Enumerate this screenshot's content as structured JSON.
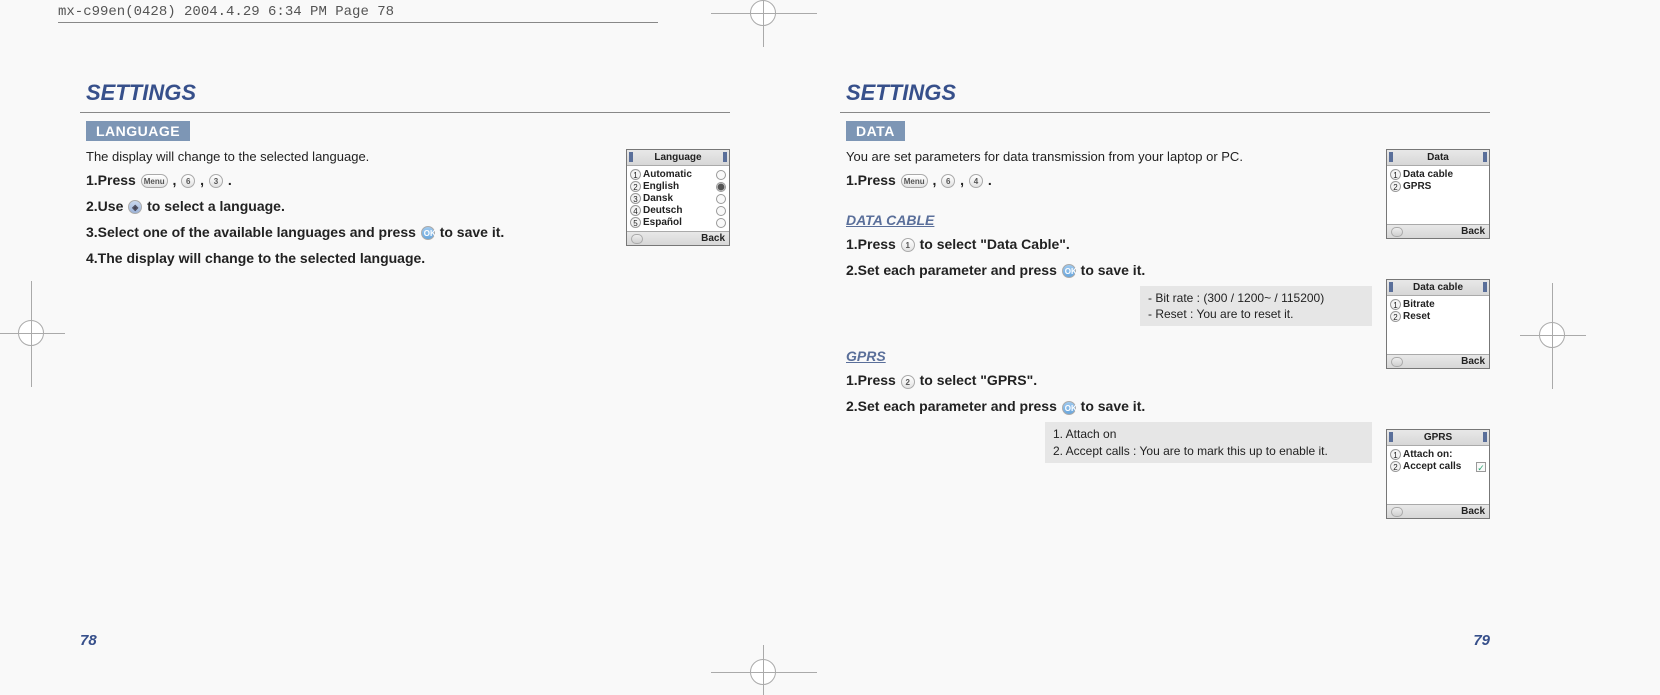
{
  "header": "mx-c99en(0428)  2004.4.29  6:34 PM  Page 78",
  "pages": {
    "left": {
      "title": "SETTINGS",
      "section": "LANGUAGE",
      "intro": "The display will change to the selected language.",
      "step1_a": "1.Press ",
      "step1_b": " , ",
      "step1_c": " , ",
      "step1_d": " .",
      "key1": "Menu",
      "key2": "6",
      "key3": "3",
      "step2_a": "2.Use ",
      "step2_b": " to select a language.",
      "step3_a": "3.Select one of the available languages and press ",
      "step3_b": " to save it.",
      "ok": "OK",
      "step4": "4.The display will change to the selected language.",
      "number": "78",
      "phone": {
        "title": "Language",
        "items": [
          {
            "n": "1",
            "label": "Automatic",
            "sel": true
          },
          {
            "n": "2",
            "label": "English",
            "sel": true
          },
          {
            "n": "3",
            "label": "Dansk",
            "sel": false
          },
          {
            "n": "4",
            "label": "Deutsch",
            "sel": false
          },
          {
            "n": "5",
            "label": "Español",
            "sel": false
          }
        ],
        "back": "Back"
      }
    },
    "right": {
      "title": "SETTINGS",
      "section": "DATA",
      "intro": "You are set parameters for data transmission from your laptop or PC.",
      "step1_a": "1.Press ",
      "step1_b": " , ",
      "step1_c": " , ",
      "step1_d": " .",
      "key1": "Menu",
      "key2": "6",
      "key3": "4",
      "sub1": "DATA CABLE",
      "dc_step1_a": "1.Press ",
      "dc_step1_b": " to select \"Data Cable\".",
      "dc_key": "1",
      "dc_step2_a": "2.Set each parameter and press  ",
      "dc_step2_b": " to save it.",
      "ok": "OK",
      "dc_note_l1": "- Bit rate : (300 / 1200~ / 115200)",
      "dc_note_l2": "- Reset : You are to reset it.",
      "sub2": "GPRS",
      "gp_step1_a": "1.Press ",
      "gp_step1_b": " to select \"GPRS\".",
      "gp_key": "2",
      "gp_step2_a": "2.Set each parameter and press  ",
      "gp_step2_b": " to save it.",
      "gp_note_l1": "1. Attach on",
      "gp_note_l2": "2. Accept calls : You are to mark this up to enable it.",
      "number": "79",
      "phone_data": {
        "title": "Data",
        "items": [
          {
            "n": "1",
            "label": "Data cable"
          },
          {
            "n": "2",
            "label": "GPRS"
          }
        ],
        "back": "Back"
      },
      "phone_cable": {
        "title": "Data cable",
        "items": [
          {
            "n": "1",
            "label": "Bitrate"
          },
          {
            "n": "2",
            "label": "Reset"
          }
        ],
        "back": "Back"
      },
      "phone_gprs": {
        "title": "GPRS",
        "items": [
          {
            "n": "1",
            "label": "Attach on:",
            "check": false
          },
          {
            "n": "2",
            "label": "Accept calls",
            "check": true
          }
        ],
        "back": "Back"
      }
    }
  }
}
